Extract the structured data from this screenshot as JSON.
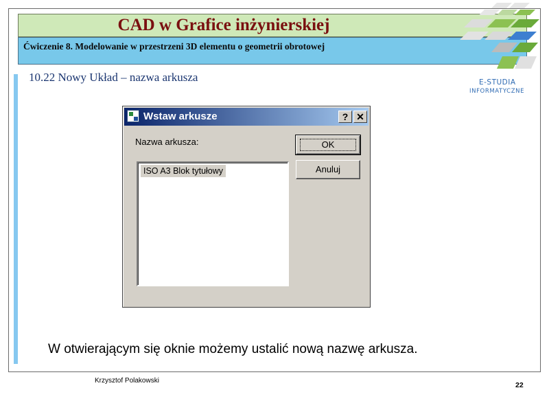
{
  "slide": {
    "title": "CAD w Grafice inżynierskiej",
    "subtitle": "Ćwiczenie 8. Modelowanie w przestrzeni 3D elementu o geometrii obrotowej",
    "section_title": "10.22 Nowy Układ – nazwa arkusza",
    "body_text": "W otwierającym się oknie możemy ustalić nową nazwę arkusza.",
    "logo_line1": "E-STUDIA",
    "logo_line2": "INFORMATYCZNE",
    "author": "Krzysztof Polakowski",
    "page_number": "22"
  },
  "dialog": {
    "title": "Wstaw arkusze",
    "help_button": "?",
    "close_button": "✕",
    "label": "Nazwa arkusza:",
    "list_items": [
      "ISO A3 Blok tytułowy"
    ],
    "ok_label": "OK",
    "cancel_label": "Anuluj"
  },
  "colors": {
    "title_text": "#7a1010",
    "title_band": "#cfe9b8",
    "subtitle_band": "#78c8ea",
    "accent_bar": "#86c8f0",
    "dialog_face": "#d4d0c8",
    "titlebar_start": "#0a246a",
    "titlebar_end": "#a6caf0",
    "logo_text": "#2f6bb3"
  }
}
